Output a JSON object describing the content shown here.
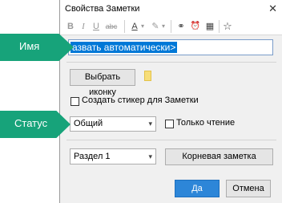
{
  "dialog": {
    "title": "Свойства Заметки",
    "close_glyph": "✕"
  },
  "toolbar": {
    "icons": [
      "bold-icon",
      "italic-icon",
      "underline-icon",
      "strikethrough-icon",
      "font-color-icon",
      "highlight-icon",
      "link-icon",
      "reminder-icon",
      "tasks-icon",
      "star-icon"
    ],
    "glyphs": {
      "bold": "B",
      "italic": "I",
      "underline": "U",
      "strike": "abc",
      "font_color": "A",
      "highlight": "✎",
      "link": "⚭",
      "reminder": "⏰",
      "tasks": "▦",
      "star": "☆",
      "dropdown": "▾"
    }
  },
  "name_field": {
    "value": "<Назвать автоматически>",
    "visible_value": "азвать автоматически>"
  },
  "icon_row": {
    "choose_icon_button": "Выбрать иконку"
  },
  "sticker_checkbox": {
    "label": "Создать стикер для Заметки",
    "checked": false
  },
  "status": {
    "selected": "Общий",
    "readonly_label": "Только чтение",
    "readonly_checked": false
  },
  "section": {
    "selected": "Раздел 1",
    "root_note_button": "Корневая заметка"
  },
  "footer": {
    "ok": "Да",
    "cancel": "Отмена"
  },
  "callouts": {
    "name": "Имя",
    "status": "Статус",
    "color": "#17a37a"
  },
  "colors": {
    "accent": "#0078d7",
    "primary_button": "#2d86d8"
  }
}
